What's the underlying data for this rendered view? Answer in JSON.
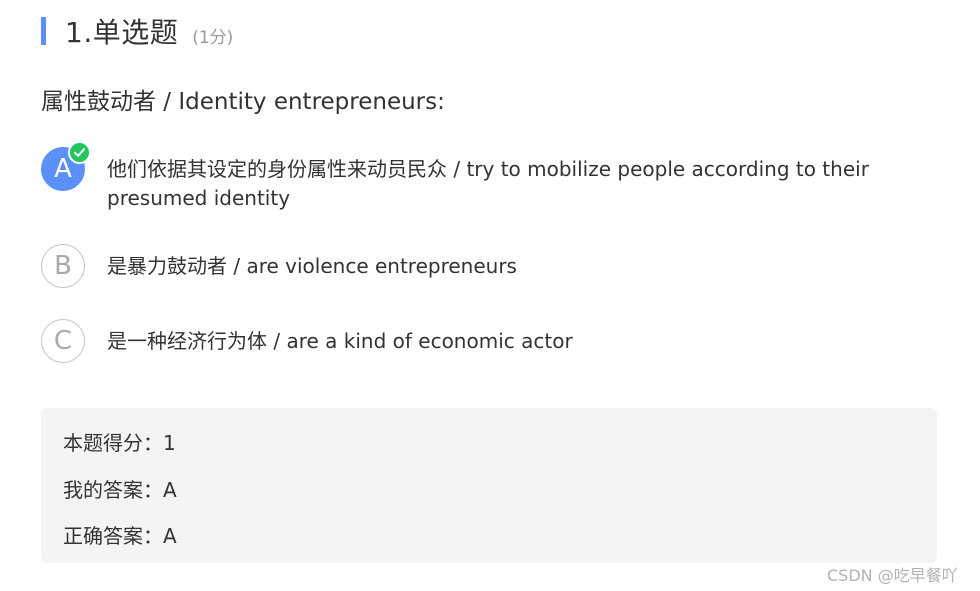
{
  "question": {
    "title": "1.单选题",
    "points": "(1分)",
    "stem": "属性鼓动者 / Identity entrepreneurs:"
  },
  "options": [
    {
      "letter": "A",
      "text": "他们依据其设定的身份属性来动员民众 / try to mobilize people according to their presumed identity",
      "selected": true
    },
    {
      "letter": "B",
      "text": "是暴力鼓动者 / are violence entrepreneurs",
      "selected": false
    },
    {
      "letter": "C",
      "text": "是一种经济行为体 / are a kind of economic actor",
      "selected": false
    }
  ],
  "result": {
    "score": "本题得分：1",
    "my_answer": "我的答案：A",
    "correct_answer": "正确答案：A"
  },
  "watermark": "CSDN @吃早餐吖",
  "colors": {
    "accent": "#5b8ff9",
    "check": "#22c55e",
    "result_bg": "#f4f4f4"
  }
}
